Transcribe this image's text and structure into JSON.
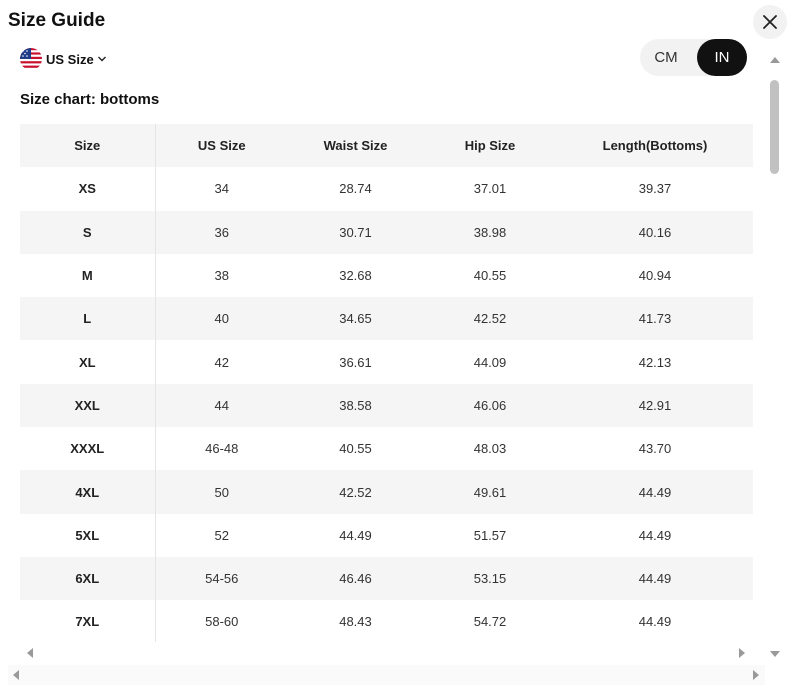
{
  "header": {
    "title": "Size Guide"
  },
  "size_system": {
    "label": "US Size",
    "flag": "us-flag-icon"
  },
  "units": {
    "cm_label": "CM",
    "in_label": "IN",
    "active": "IN"
  },
  "chart": {
    "subtitle": "Size chart: bottoms",
    "columns": [
      "Size",
      "US Size",
      "Waist Size",
      "Hip Size",
      "Length(Bottoms)"
    ],
    "rows": [
      [
        "XS",
        "34",
        "28.74",
        "37.01",
        "39.37"
      ],
      [
        "S",
        "36",
        "30.71",
        "38.98",
        "40.16"
      ],
      [
        "M",
        "38",
        "32.68",
        "40.55",
        "40.94"
      ],
      [
        "L",
        "40",
        "34.65",
        "42.52",
        "41.73"
      ],
      [
        "XL",
        "42",
        "36.61",
        "44.09",
        "42.13"
      ],
      [
        "XXL",
        "44",
        "38.58",
        "46.06",
        "42.91"
      ],
      [
        "XXXL",
        "46-48",
        "40.55",
        "48.03",
        "43.70"
      ],
      [
        "4XL",
        "50",
        "42.52",
        "49.61",
        "44.49"
      ],
      [
        "5XL",
        "52",
        "44.49",
        "51.57",
        "44.49"
      ],
      [
        "6XL",
        "54-56",
        "46.46",
        "53.15",
        "44.49"
      ],
      [
        "7XL",
        "58-60",
        "48.43",
        "54.72",
        "44.49"
      ]
    ]
  },
  "colors": {
    "active_toggle": "#111111",
    "row_stripe": "#f5f5f5"
  }
}
